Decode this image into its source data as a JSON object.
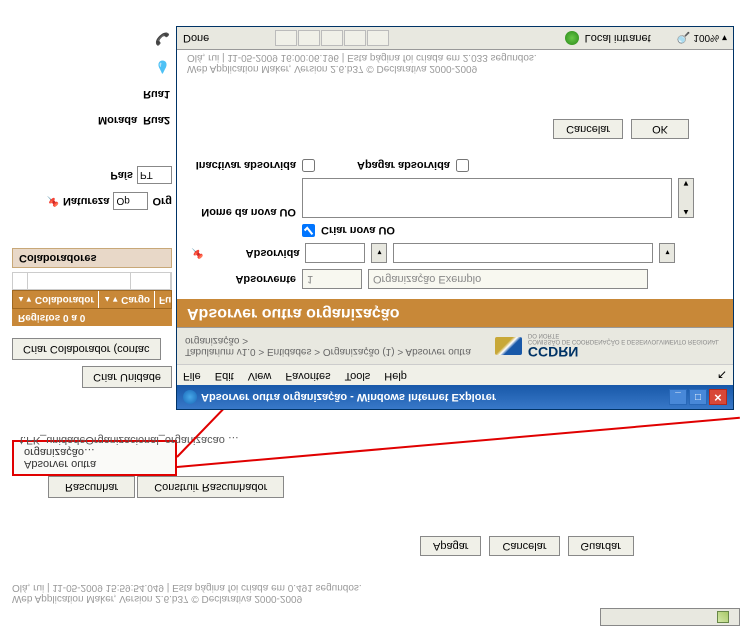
{
  "status_line": "Web Application Maker, Version 2.6.b37 © Declarativa 2000-2009",
  "status_detail": "Olá, rui | 11-05-2009 15:59:54.049 | Esta página foi criada em 0.491 segundos.",
  "top_buttons": {
    "apagar": "Apagar",
    "cancelar": "Cancelar",
    "guardar": "Guardar"
  },
  "tabs": {
    "rascunhar": "Rascunhar",
    "construir": "Construir Rascunhador"
  },
  "red_link": "Absorver outra organização…",
  "fk_link": "t.FK_unidadeOrganizacional_organizacao …",
  "left": {
    "criar_unidade": "Criar Unidade",
    "criar_colab": "Criar Colaborador (contac",
    "registos": "Registos 0 a 0",
    "col_colaborador": "Colaborador",
    "col_cargo": "Cargo",
    "col_fu": "Fu",
    "colaboradores": "Colaboradores"
  },
  "form_left": {
    "natureza": "Natureza",
    "natureza_val": "Op",
    "org": "Org",
    "pais": "País",
    "pais_val": "PT",
    "rua2": "Rua2",
    "morada": "Morada",
    "rua1": "Rua1"
  },
  "popup": {
    "title": "Absorver outra organização - Windows Internet Explorer",
    "menu": {
      "file": "File",
      "edit": "Edit",
      "view": "View",
      "favorites": "Favorites",
      "tools": "Tools",
      "help": "Help"
    },
    "breadcrumb": "Tabularium v1.0 > Entidades > Organização (1) > Absorver outra organização >",
    "logo": "CCDRN",
    "logo_sub": "COMISSÃO DE COORDENAÇÃO E DESENVOLVIMENTO REGIONAL DO NORTE",
    "heading": "Absorver outra organização",
    "labels": {
      "absorvente": "Absorvente",
      "absorvida": "Absorvida",
      "criar_nova": "Criar nova UO",
      "nome_nova": "Nome da nova UO",
      "inactivar": "Inactivar absorvida",
      "apagar": "Apagar absorvida"
    },
    "absorvente_id": "1",
    "absorvente_nome": "Organização Exemplo",
    "buttons": {
      "cancelar": "Cancelar",
      "ok": "OK"
    },
    "footer1": "Web Application Maker, Version 2.6.b37 © Declarativa 2000-2009",
    "footer2": "Olá, rui | 11-05-2009 16:00:06.196 | Esta página foi criada em 2.033 segundos.",
    "status": {
      "done": "Done",
      "intranet": "Local intranet",
      "zoom": "100%"
    }
  }
}
